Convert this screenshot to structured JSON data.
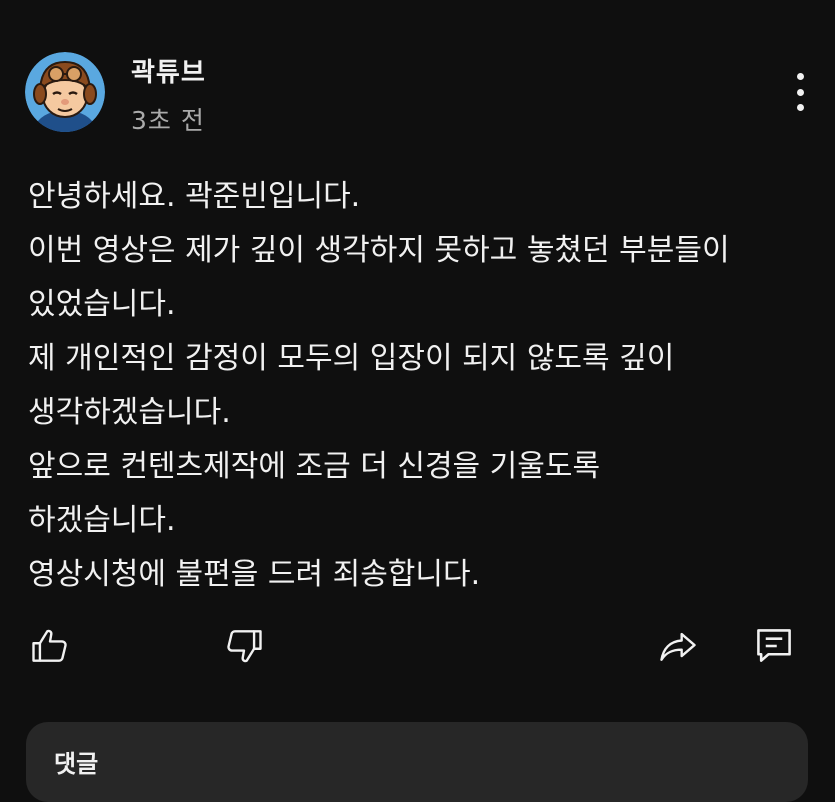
{
  "comment": {
    "author": "곽튜브",
    "timestamp": "3초 전",
    "avatar_icon": "cartoon-avatar-icon",
    "menu_icon": "more-vertical-icon",
    "body_lines": [
      "안녕하세요. 곽준빈입니다.",
      "이번 영상은 제가 깊이 생각하지 못하고 놓쳤던 부분들이",
      "있었습니다.",
      "제 개인적인 감정이 모두의 입장이 되지 않도록 깊이",
      "생각하겠습니다.",
      "앞으로 컨텐츠제작에 조금 더 신경을 기울도록",
      "하겠습니다.",
      "영상시청에 불편을 드려 죄송합니다."
    ]
  },
  "actions": {
    "like_icon": "thumbs-up-icon",
    "dislike_icon": "thumbs-down-icon",
    "share_icon": "share-icon",
    "reply_icon": "comment-icon"
  },
  "reply_panel": {
    "label": "댓글"
  },
  "colors": {
    "background": "#0f0f0f",
    "text_primary": "#f1f1f1",
    "text_secondary": "#aaaaaa",
    "panel": "#272727"
  }
}
